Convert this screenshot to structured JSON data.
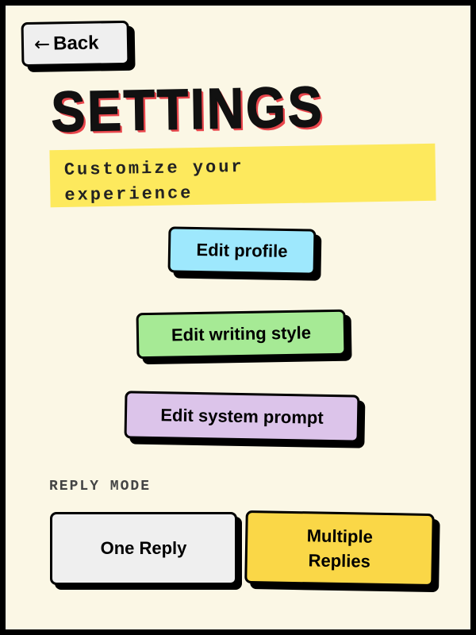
{
  "back_button": {
    "arrow": "←",
    "label": "Back"
  },
  "header": {
    "title": "SETTINGS",
    "subtitle_line1": "Customize your",
    "subtitle_line2": "experience"
  },
  "actions": {
    "edit_profile": "Edit profile",
    "edit_writing_style": "Edit writing style",
    "edit_system_prompt": "Edit system prompt"
  },
  "reply_mode": {
    "label": "REPLY MODE",
    "one_reply": "One Reply",
    "multiple_line1": "Multiple",
    "multiple_line2": "Replies",
    "selected": "Multiple Replies"
  },
  "colors": {
    "background": "#fbf7e5",
    "subtitle_highlight": "#fde95d",
    "edit_profile": "#9ee8fd",
    "edit_writing_style": "#a6ea95",
    "edit_system_prompt": "#dcc4ea",
    "selected_mode": "#fad747",
    "title_shadow": "#e8464c"
  }
}
